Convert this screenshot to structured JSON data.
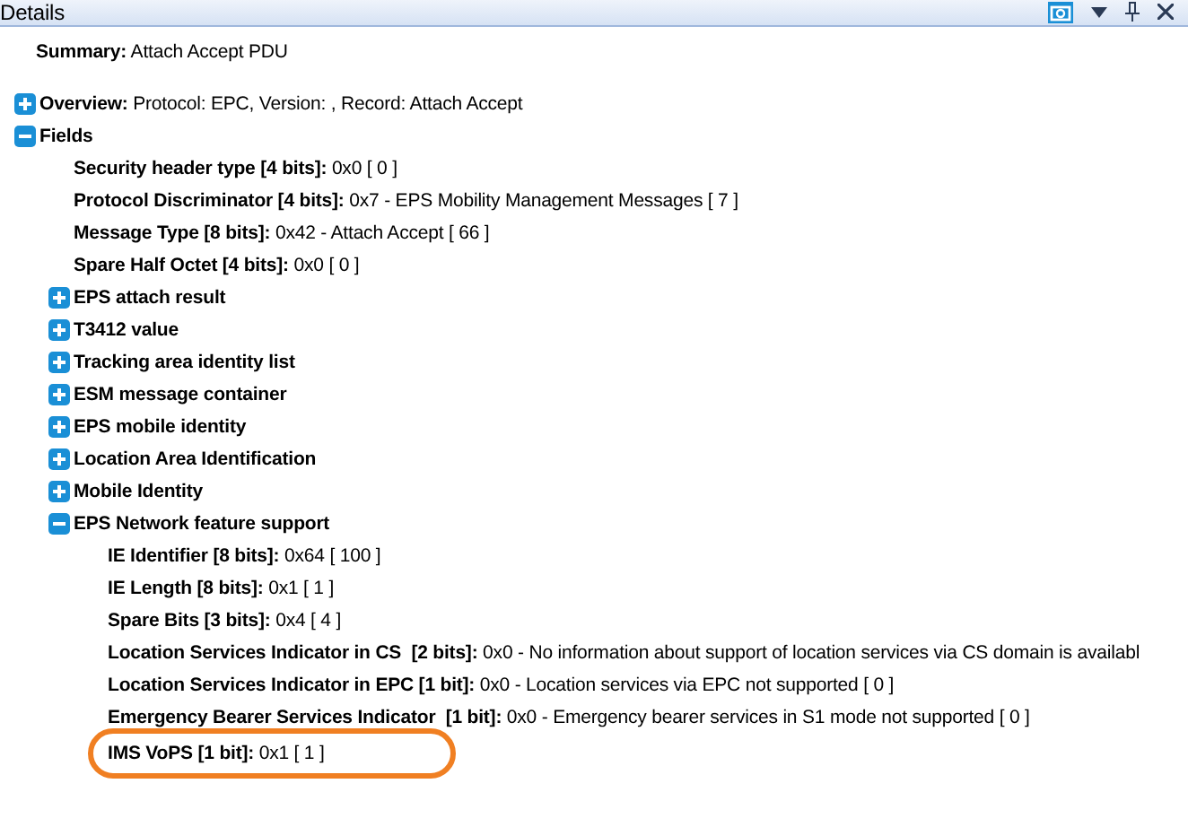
{
  "panel": {
    "title": "Details"
  },
  "summary": {
    "label": "Summary:",
    "value": "Attach Accept PDU"
  },
  "tree": [
    {
      "label": "Overview:",
      "value": "Protocol: EPC, Version: , Record: Attach Accept",
      "expanded": false
    },
    {
      "label": "Fields",
      "expanded": true,
      "children": [
        {
          "label": "Security header type [4 bits]:",
          "value": "0x0 [ 0 ]"
        },
        {
          "label": "Protocol Discriminator [4 bits]:",
          "value": "0x7 - EPS Mobility Management Messages [ 7 ]"
        },
        {
          "label": "Message Type [8 bits]:",
          "value": "0x42 - Attach Accept [ 66 ]"
        },
        {
          "label": "Spare Half Octet [4 bits]:",
          "value": "0x0 [ 0 ]"
        },
        {
          "label": "EPS attach result",
          "expanded": false
        },
        {
          "label": "T3412 value",
          "expanded": false
        },
        {
          "label": "Tracking area identity list",
          "expanded": false
        },
        {
          "label": "ESM message container",
          "expanded": false
        },
        {
          "label": "EPS mobile identity",
          "expanded": false
        },
        {
          "label": "Location Area Identification",
          "expanded": false
        },
        {
          "label": "Mobile Identity",
          "expanded": false
        },
        {
          "label": "EPS Network feature support",
          "expanded": true,
          "children": [
            {
              "label": "IE Identifier [8 bits]:",
              "value": "0x64 [ 100 ]"
            },
            {
              "label": "IE Length [8 bits]:",
              "value": "0x1 [ 1 ]"
            },
            {
              "label": "Spare Bits [3 bits]:",
              "value": "0x4 [ 4 ]"
            },
            {
              "label": "Location Services Indicator in CS  [2 bits]:",
              "value": "0x0 - No information about support of location services via CS domain is availabl"
            },
            {
              "label": "Location Services Indicator in EPC [1 bit]:",
              "value": "0x0 - Location services via EPC not supported [ 0 ]"
            },
            {
              "label": "Emergency Bearer Services Indicator  [1 bit]:",
              "value": "0x0 - Emergency bearer services in S1 mode not supported [ 0 ]"
            },
            {
              "label": "IMS VoPS [1 bit]:",
              "value": "0x1 [ 1 ]",
              "highlighted": true
            }
          ]
        }
      ]
    }
  ]
}
